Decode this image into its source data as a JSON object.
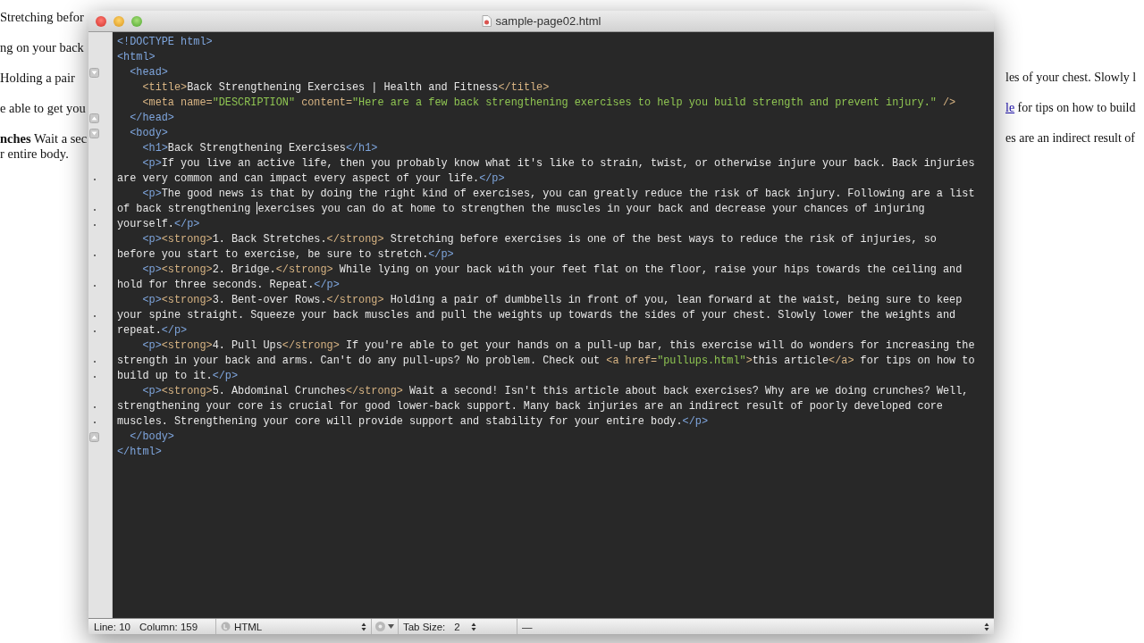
{
  "background_page": {
    "left_lines": [
      "Stretching befor",
      "ng on your back",
      "Holding a pair",
      "e able to get you",
      "**nches** Wait a sec",
      "r entire body."
    ],
    "right_lines": [
      {
        "text": "les of your chest. Slowly l"
      },
      {
        "link": "le",
        "text": " for tips on how to build"
      },
      {
        "text": "es are an indirect result of"
      }
    ]
  },
  "window": {
    "title": "sample-page02.html"
  },
  "editor": {
    "rows": [
      {
        "kind": "line",
        "tokens": [
          {
            "kind": "tag",
            "text": "<!DOCTYPE html>"
          }
        ]
      },
      {
        "kind": "line",
        "tokens": [
          {
            "kind": "tag",
            "text": "<html>"
          }
        ]
      },
      {
        "kind": "fold-start",
        "tokens": [
          {
            "kind": "tag",
            "text": "  <head>"
          }
        ]
      },
      {
        "kind": "line",
        "tokens": [
          {
            "kind": "tag2",
            "text": "    <title>"
          },
          {
            "kind": "text",
            "text": "Back Strengthening Exercises | Health and Fitness"
          },
          {
            "kind": "tag2",
            "text": "</title>"
          }
        ]
      },
      {
        "kind": "line",
        "tokens": [
          {
            "kind": "tag2",
            "text": "    <meta name="
          },
          {
            "kind": "string",
            "text": "\"DESCRIPTION\""
          },
          {
            "kind": "tag2",
            "text": " content="
          },
          {
            "kind": "string",
            "text": "\"Here are a few back strengthening exercises to help you build strength and prevent injury.\""
          },
          {
            "kind": "tag2",
            "text": " />"
          }
        ]
      },
      {
        "kind": "fold-end",
        "tokens": [
          {
            "kind": "tag",
            "text": "  </head>"
          }
        ]
      },
      {
        "kind": "fold-start",
        "tokens": [
          {
            "kind": "tag",
            "text": "  <body>"
          }
        ]
      },
      {
        "kind": "line",
        "tokens": [
          {
            "kind": "tag",
            "text": "    <h1>"
          },
          {
            "kind": "text",
            "text": "Back Strengthening Exercises"
          },
          {
            "kind": "tag",
            "text": "</h1>"
          }
        ]
      },
      {
        "kind": "line",
        "tokens": [
          {
            "kind": "tag",
            "text": "    <p>"
          },
          {
            "kind": "text",
            "text": "If you live an active life, then you probably know what it's like to strain, twist, or otherwise injure your back. Back injuries"
          }
        ]
      },
      {
        "kind": "wrap",
        "tokens": [
          {
            "kind": "text",
            "text": "are very common and can impact every aspect of your life."
          },
          {
            "kind": "tag",
            "text": "</p>"
          }
        ]
      },
      {
        "kind": "line",
        "tokens": [
          {
            "kind": "tag",
            "text": "    <p>"
          },
          {
            "kind": "text",
            "text": "The good news is that by doing the right kind of exercises, you can greatly reduce the risk of back injury. Following are a list"
          }
        ]
      },
      {
        "kind": "wrap",
        "tokens": [
          {
            "kind": "text",
            "text": "of back strengthening "
          },
          {
            "kind": "caret"
          },
          {
            "kind": "text",
            "text": "exercises you can do at home to strengthen the muscles in your back and decrease your chances of injuring"
          }
        ]
      },
      {
        "kind": "wrap",
        "tokens": [
          {
            "kind": "text",
            "text": "yourself."
          },
          {
            "kind": "tag",
            "text": "</p>"
          }
        ]
      },
      {
        "kind": "line",
        "tokens": [
          {
            "kind": "tag",
            "text": "    <p>"
          },
          {
            "kind": "tag2",
            "text": "<strong>"
          },
          {
            "kind": "text",
            "text": "1. Back Stretches."
          },
          {
            "kind": "tag2",
            "text": "</strong>"
          },
          {
            "kind": "text",
            "text": " Stretching before exercises is one of the best ways to reduce the risk of injuries, so"
          }
        ]
      },
      {
        "kind": "wrap",
        "tokens": [
          {
            "kind": "text",
            "text": "before you start to exercise, be sure to stretch."
          },
          {
            "kind": "tag",
            "text": "</p>"
          }
        ]
      },
      {
        "kind": "line",
        "tokens": [
          {
            "kind": "tag",
            "text": "    <p>"
          },
          {
            "kind": "tag2",
            "text": "<strong>"
          },
          {
            "kind": "text",
            "text": "2. Bridge."
          },
          {
            "kind": "tag2",
            "text": "</strong>"
          },
          {
            "kind": "text",
            "text": " While lying on your back with your feet flat on the floor, raise your hips towards the ceiling and"
          }
        ]
      },
      {
        "kind": "wrap",
        "tokens": [
          {
            "kind": "text",
            "text": "hold for three seconds. Repeat."
          },
          {
            "kind": "tag",
            "text": "</p>"
          }
        ]
      },
      {
        "kind": "line",
        "tokens": [
          {
            "kind": "tag",
            "text": "    <p>"
          },
          {
            "kind": "tag2",
            "text": "<strong>"
          },
          {
            "kind": "text",
            "text": "3. Bent-over Rows."
          },
          {
            "kind": "tag2",
            "text": "</strong>"
          },
          {
            "kind": "text",
            "text": " Holding a pair of dumbbells in front of you, lean forward at the waist, being sure to keep"
          }
        ]
      },
      {
        "kind": "wrap",
        "tokens": [
          {
            "kind": "text",
            "text": "your spine straight. Squeeze your back muscles and pull the weights up towards the sides of your chest. Slowly lower the weights and"
          }
        ]
      },
      {
        "kind": "wrap",
        "tokens": [
          {
            "kind": "text",
            "text": "repeat."
          },
          {
            "kind": "tag",
            "text": "</p>"
          }
        ]
      },
      {
        "kind": "line",
        "tokens": [
          {
            "kind": "tag",
            "text": "    <p>"
          },
          {
            "kind": "tag2",
            "text": "<strong>"
          },
          {
            "kind": "text",
            "text": "4. Pull Ups"
          },
          {
            "kind": "tag2",
            "text": "</strong>"
          },
          {
            "kind": "text",
            "text": " If you're able to get your hands on a pull-up bar, this exercise will do wonders for increasing the"
          }
        ]
      },
      {
        "kind": "wrap",
        "tokens": [
          {
            "kind": "text",
            "text": "strength in your back and arms. Can't do any pull-ups? No problem. Check out "
          },
          {
            "kind": "tag2",
            "text": "<a href="
          },
          {
            "kind": "string",
            "text": "\"pullups.html\""
          },
          {
            "kind": "tag2",
            "text": ">"
          },
          {
            "kind": "text",
            "text": "this article"
          },
          {
            "kind": "tag2",
            "text": "</a>"
          },
          {
            "kind": "text",
            "text": " for tips on how to"
          }
        ]
      },
      {
        "kind": "wrap",
        "tokens": [
          {
            "kind": "text",
            "text": "build up to it."
          },
          {
            "kind": "tag",
            "text": "</p>"
          }
        ]
      },
      {
        "kind": "line",
        "tokens": [
          {
            "kind": "tag",
            "text": "    <p>"
          },
          {
            "kind": "tag2",
            "text": "<strong>"
          },
          {
            "kind": "text",
            "text": "5. Abdominal Crunches"
          },
          {
            "kind": "tag2",
            "text": "</strong>"
          },
          {
            "kind": "text",
            "text": " Wait a second! Isn't this article about back exercises? Why are we doing crunches? Well,"
          }
        ]
      },
      {
        "kind": "wrap",
        "tokens": [
          {
            "kind": "text",
            "text": "strengthening your core is crucial for good lower-back support. Many back injuries are an indirect result of poorly developed core"
          }
        ]
      },
      {
        "kind": "wrap",
        "tokens": [
          {
            "kind": "text",
            "text": "muscles. Strengthening your core will provide support and stability for your entire body."
          },
          {
            "kind": "tag",
            "text": "</p>"
          }
        ]
      },
      {
        "kind": "fold-end",
        "tokens": [
          {
            "kind": "tag",
            "text": "  </body>"
          }
        ]
      },
      {
        "kind": "line",
        "tokens": [
          {
            "kind": "tag",
            "text": "</html>"
          }
        ]
      }
    ]
  },
  "status_bar": {
    "line": "Line: 10",
    "column": "Column: 159",
    "syntax": "HTML",
    "tab_size_label": "Tab Size:",
    "tab_size": "2",
    "symbol": "—"
  }
}
